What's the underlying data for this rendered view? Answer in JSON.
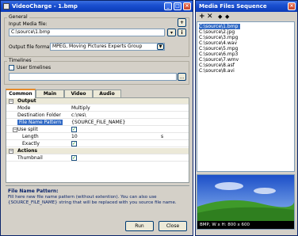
{
  "main_window": {
    "title": "VideoCharge - 1.bmp",
    "general_group": "General",
    "input_label": "Input Media file:",
    "input_value": "C:\\source\\1.bmp",
    "add_button": "+",
    "info_button": "i",
    "output_format_label": "Output file format:",
    "output_format_value": "MPEG, Moving Pictures Experts Group",
    "timelines_group": "Timelines",
    "user_timelines_label": "User timelines",
    "timeline_value": "",
    "browse_button": "...",
    "tabs": [
      "Common",
      "Main",
      "Video",
      "Audio"
    ],
    "properties": [
      {
        "type": "cat",
        "name": "Output",
        "expander": "−"
      },
      {
        "type": "row",
        "name": "Mode",
        "value": "Multiply"
      },
      {
        "type": "row",
        "name": "Destination Folder",
        "value": "c:\\res\\"
      },
      {
        "type": "sel",
        "name": "File Name Pattern",
        "value": "{SOURCE_FILE_NAME}"
      },
      {
        "type": "row",
        "name": "Use split",
        "value": "",
        "check": "✓",
        "expander": "−"
      },
      {
        "type": "sub",
        "name": "Length",
        "value": "10",
        "unit": "s"
      },
      {
        "type": "sub",
        "name": "Exactly",
        "value": "",
        "check": "✓"
      },
      {
        "type": "cat",
        "name": "Actions",
        "expander": "−"
      },
      {
        "type": "row",
        "name": "Thumbnail",
        "value": "",
        "check": "✓"
      }
    ],
    "help_title": "File Name Pattern:",
    "help_text": "Fill here new file name pattern (without extention). You can also use {SOURCE_FILE_NAME} string that will be replaced with you source file name.",
    "run_button": "Run",
    "close_button": "Close"
  },
  "sequence_window": {
    "title": "Media Files Sequence",
    "toolbar_icons": [
      "add-icon",
      "delete-icon",
      "move-up-icon",
      "move-down-icon"
    ],
    "files": [
      "C:\\source\\1.bmp",
      "C:\\source\\2.jpg",
      "C:\\source\\3.mpg",
      "C:\\source\\4.wav",
      "C:\\source\\5.mpg",
      "C:\\source\\6.mp3",
      "C:\\source\\7.wmv",
      "C:\\source\\8.asf",
      "C:\\source\\8.avi"
    ],
    "selected_index": 0,
    "preview_caption": "BMP, W x H: 800 x 600"
  },
  "colors": {
    "title_blue": "#0b3bb8",
    "selection": "#316ac5",
    "tab_accent": "#e68b2c"
  }
}
